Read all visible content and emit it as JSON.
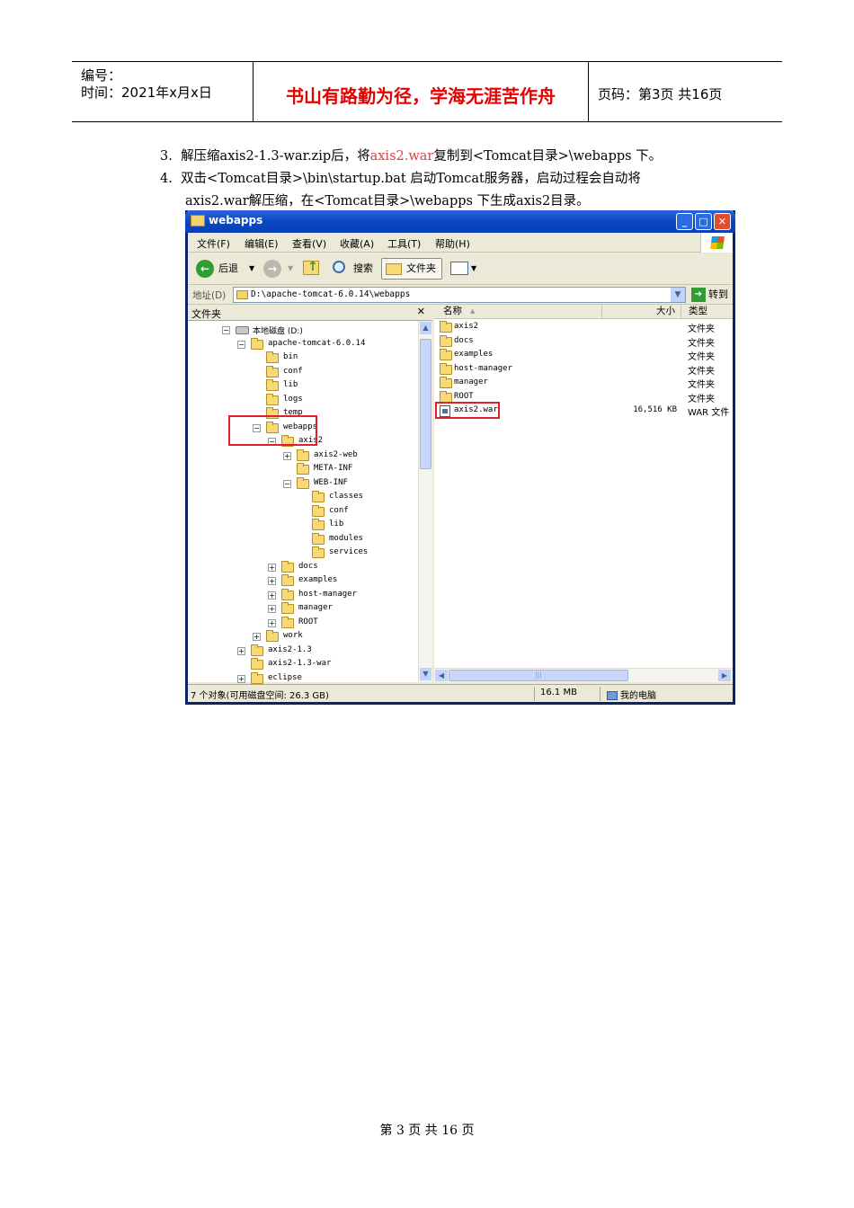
{
  "header": {
    "number_label": "编号：",
    "time_label": "时间：2021年x月x日",
    "motto": "书山有路勤为径，学海无涯苦作舟",
    "page_label": "页码：第3页  共16页"
  },
  "steps": [
    {
      "num": "3.",
      "pre": "解压缩axis2-1.3-war.zip后，将",
      "highlight": "axis2.war",
      "post": "复制到<Tomcat目录>\\webapps 下。"
    },
    {
      "num": "4.",
      "line1": "双击<Tomcat目录>\\bin\\startup.bat 启动Tomcat服务器，启动过程会自动将",
      "line2": "axis2.war解压缩，在<Tomcat目录>\\webapps 下生成axis2目录。"
    }
  ],
  "window": {
    "title": "webapps",
    "buttons": {
      "minimize": "_",
      "maximize": "□",
      "close": "✕"
    },
    "menu": [
      "文件(F)",
      "编辑(E)",
      "查看(V)",
      "收藏(A)",
      "工具(T)",
      "帮助(H)"
    ],
    "toolbar": {
      "back": "后退",
      "search": "搜索",
      "folders": "文件夹"
    },
    "address": {
      "label": "地址(D)",
      "path": "D:\\apache-tomcat-6.0.14\\webapps",
      "go": "转到"
    },
    "tree_header": "文件夹",
    "tree": [
      {
        "name": "本地磁盘 (D:)",
        "expander": "−",
        "depth": 0,
        "drive": true
      },
      {
        "name": "apache-tomcat-6.0.14",
        "expander": "−",
        "depth": 1
      },
      {
        "name": "bin",
        "expander": "",
        "depth": 2
      },
      {
        "name": "conf",
        "expander": "",
        "depth": 2
      },
      {
        "name": "lib",
        "expander": "",
        "depth": 2
      },
      {
        "name": "logs",
        "expander": "",
        "depth": 2
      },
      {
        "name": "temp",
        "expander": "",
        "depth": 2
      },
      {
        "name": "webapps",
        "expander": "−",
        "depth": 2
      },
      {
        "name": "axis2",
        "expander": "−",
        "depth": 3
      },
      {
        "name": "axis2-web",
        "expander": "+",
        "depth": 4
      },
      {
        "name": "META-INF",
        "expander": "",
        "depth": 4
      },
      {
        "name": "WEB-INF",
        "expander": "−",
        "depth": 4
      },
      {
        "name": "classes",
        "expander": "",
        "depth": 5
      },
      {
        "name": "conf",
        "expander": "",
        "depth": 5
      },
      {
        "name": "lib",
        "expander": "",
        "depth": 5
      },
      {
        "name": "modules",
        "expander": "",
        "depth": 5
      },
      {
        "name": "services",
        "expander": "",
        "depth": 5
      },
      {
        "name": "docs",
        "expander": "+",
        "depth": 3
      },
      {
        "name": "examples",
        "expander": "+",
        "depth": 3
      },
      {
        "name": "host-manager",
        "expander": "+",
        "depth": 3
      },
      {
        "name": "manager",
        "expander": "+",
        "depth": 3
      },
      {
        "name": "ROOT",
        "expander": "+",
        "depth": 3
      },
      {
        "name": "work",
        "expander": "+",
        "depth": 2
      },
      {
        "name": "axis2-1.3",
        "expander": "+",
        "depth": 1
      },
      {
        "name": "axis2-1.3-war",
        "expander": "",
        "depth": 1
      },
      {
        "name": "eclipse",
        "expander": "+",
        "depth": 1
      }
    ],
    "columns": {
      "name": "名称",
      "size": "大小",
      "type": "类型"
    },
    "files": [
      {
        "name": "axis2",
        "size": "",
        "type": "文件夹",
        "kind": "folder"
      },
      {
        "name": "docs",
        "size": "",
        "type": "文件夹",
        "kind": "folder"
      },
      {
        "name": "examples",
        "size": "",
        "type": "文件夹",
        "kind": "folder"
      },
      {
        "name": "host-manager",
        "size": "",
        "type": "文件夹",
        "kind": "folder"
      },
      {
        "name": "manager",
        "size": "",
        "type": "文件夹",
        "kind": "folder"
      },
      {
        "name": "ROOT",
        "size": "",
        "type": "文件夹",
        "kind": "folder"
      },
      {
        "name": "axis2.war",
        "size": "16,516 KB",
        "type": "WAR 文件",
        "kind": "war"
      }
    ],
    "status": {
      "objects": "7 个对象(可用磁盘空间: 26.3 GB)",
      "size": "16.1 MB",
      "location": "我的电脑"
    }
  },
  "footer": "第 3 页 共 16 页"
}
